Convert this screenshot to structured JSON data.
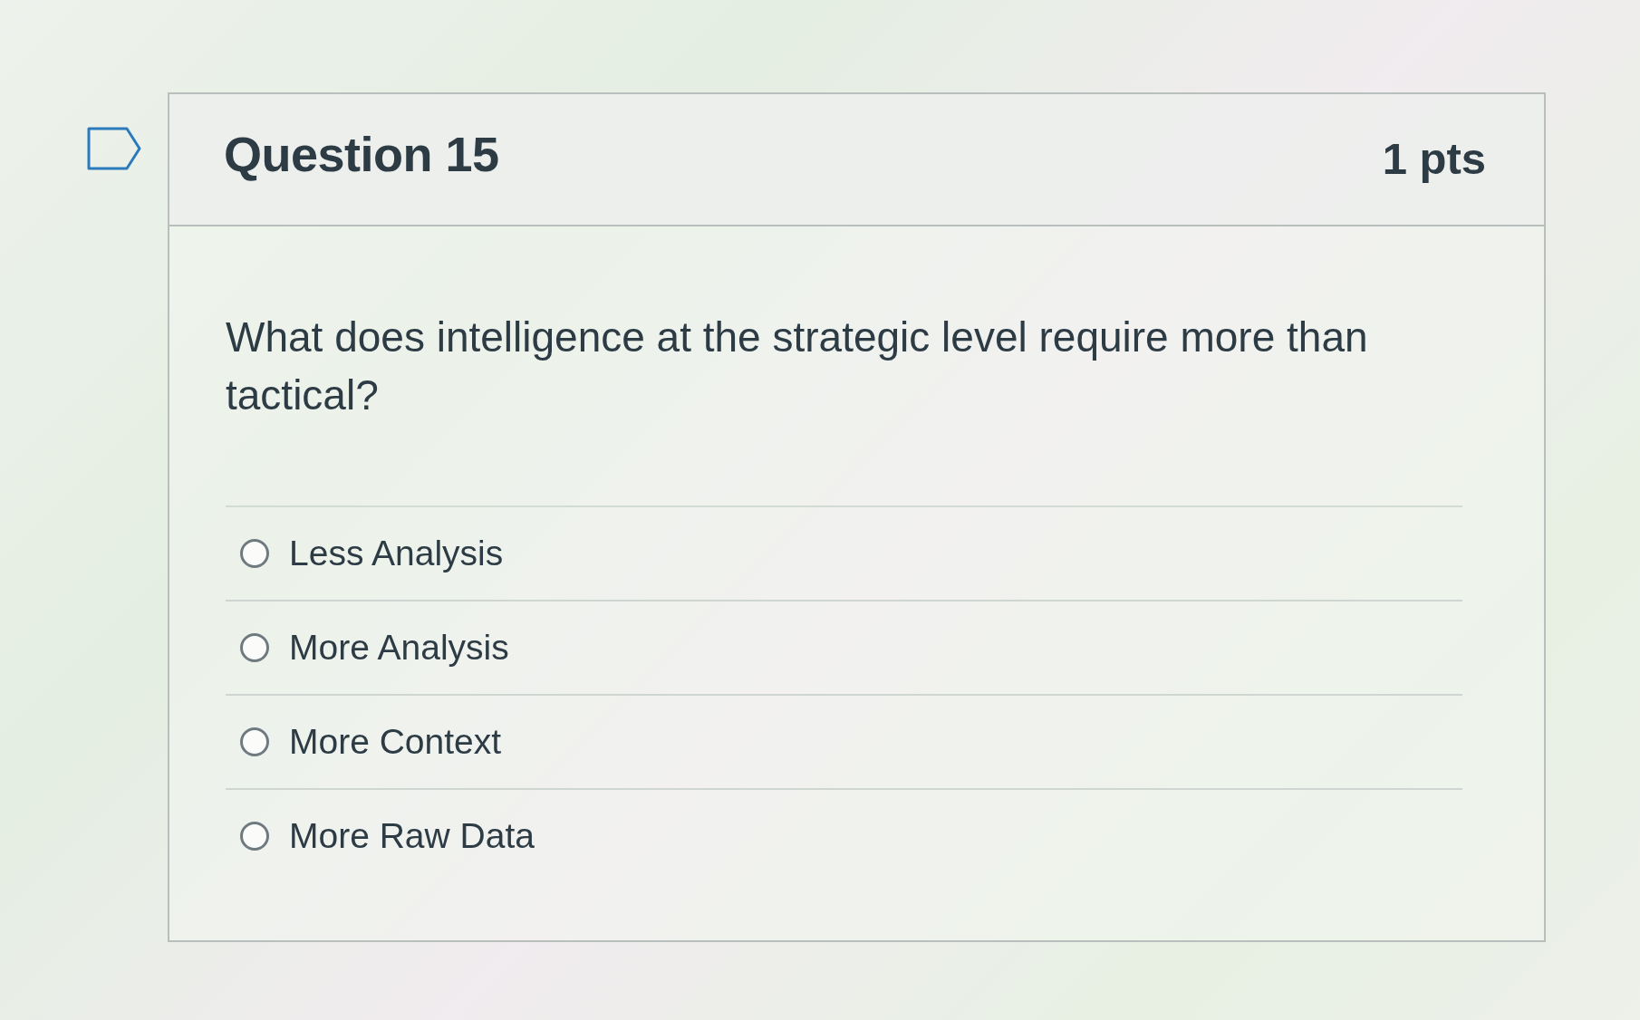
{
  "question": {
    "flagged": false,
    "title": "Question 15",
    "points": "1 pts",
    "text": "What does intelligence at the strategic level require more than tactical?"
  },
  "answers": [
    {
      "label": "Less Analysis",
      "selected": false
    },
    {
      "label": "More Analysis",
      "selected": false
    },
    {
      "label": "More Context",
      "selected": false
    },
    {
      "label": "More Raw Data",
      "selected": false
    }
  ]
}
